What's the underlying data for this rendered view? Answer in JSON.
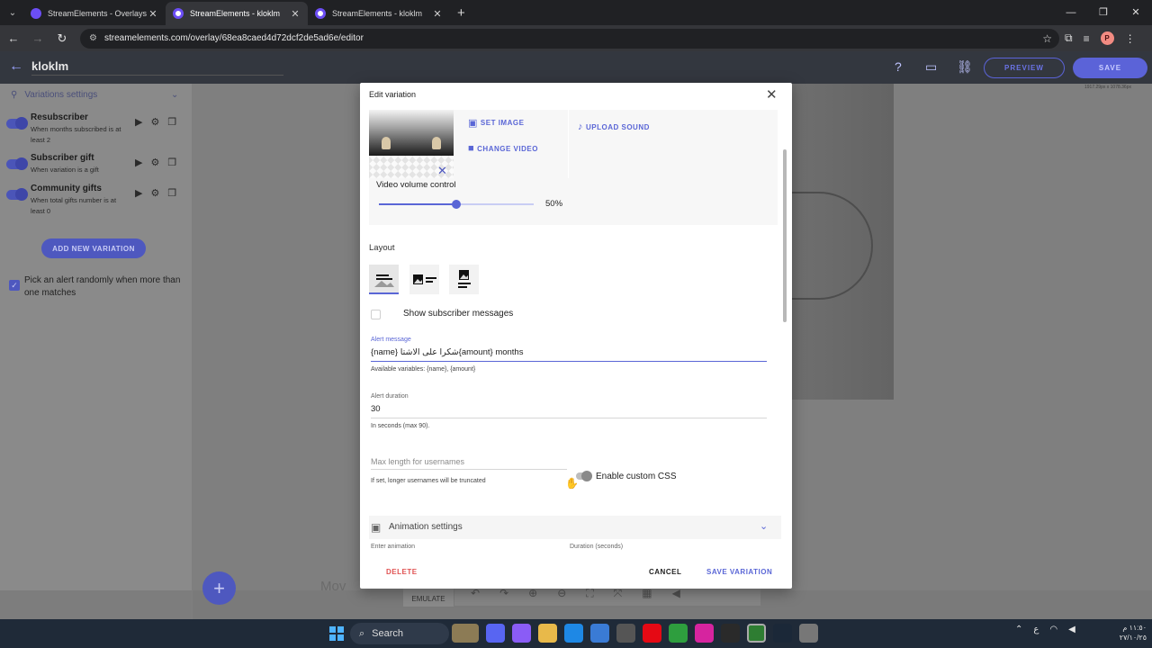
{
  "browser": {
    "tabs": [
      {
        "title": "StreamElements - Overlays",
        "active": false
      },
      {
        "title": "StreamElements - kloklm",
        "active": true
      },
      {
        "title": "StreamElements - kloklm",
        "active": false
      }
    ],
    "url": "streamelements.com/overlay/68ea8caed4d72dcf2de5ad6e/editor",
    "profile_initial": "P"
  },
  "header": {
    "title": "kloklm",
    "preview_label": "PREVIEW",
    "save_label": "SAVE"
  },
  "sidebar": {
    "section_title": "Variations settings",
    "variations": [
      {
        "name": "Resubscriber",
        "desc": "When months subscribed is at least 2"
      },
      {
        "name": "Subscriber gift",
        "desc": "When variation is a gift"
      },
      {
        "name": "Community gifts",
        "desc": "When total gifts number is at least 0"
      }
    ],
    "add_label": "ADD NEW VARIATION",
    "random_label": "Pick an alert randomly when more than one matches"
  },
  "canvas": {
    "move_text": "Mov",
    "emulate_label": "EMULATE",
    "size_readout": "1917.29px x 1078.36px"
  },
  "modal": {
    "title": "Edit variation",
    "set_image": "SET IMAGE",
    "change_video": "CHANGE VIDEO",
    "upload_sound": "UPLOAD SOUND",
    "volume_label": "Video volume control",
    "volume_value": 50,
    "volume_text": "50%",
    "layout_label": "Layout",
    "show_messages_label": "Show subscriber messages",
    "alert_message_label": "Alert message",
    "alert_message_value": "{name} شكرا على الاشتا{amount} months",
    "alert_message_help": "Available variables: {name}, {amount}",
    "alert_duration_label": "Alert duration",
    "alert_duration_value": "30",
    "alert_duration_help": "In seconds (max 90).",
    "max_length_placeholder": "Max length for usernames",
    "max_length_help": "If set, longer usernames will be truncated",
    "custom_css_label": "Enable custom CSS",
    "animation_settings_label": "Animation settings",
    "enter_animation_label": "Enter animation",
    "duration_label": "Duration (seconds)",
    "delete_label": "DELETE",
    "cancel_label": "CANCEL",
    "save_variation_label": "SAVE VARIATION"
  },
  "taskbar": {
    "search_placeholder": "Search",
    "clock_time": "١١:٥٠ م",
    "clock_date": "٢٧/١٠/٢٥"
  },
  "colors": {
    "accent": "#5a66d6",
    "delete": "#e05252",
    "header_bg": "#33373f"
  }
}
